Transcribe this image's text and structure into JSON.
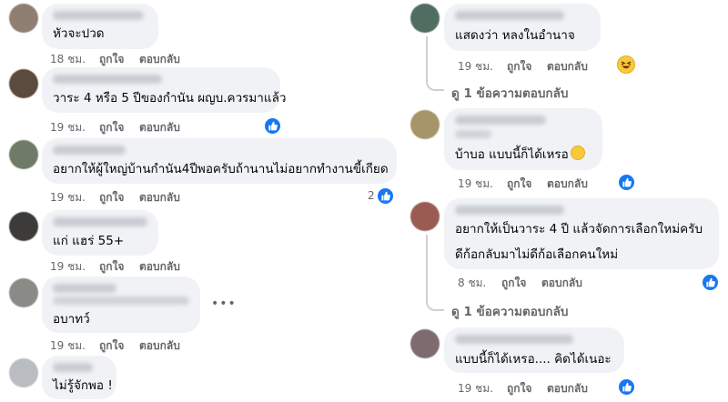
{
  "left_comments": [
    {
      "text": "หัวจะปวด",
      "time": "18 ชม.",
      "like": "ถูกใจ",
      "reply": "ตอบกลับ"
    },
    {
      "text": "วาระ 4 หรือ 5 ปีของกำนัน ผญบ.ควรมาแล้ว",
      "time": "19 ชม.",
      "like": "ถูกใจ",
      "reply": "ตอบกลับ"
    },
    {
      "text": "อยากให้ผู้ใหญ่บ้านกำนัน4ปีพอครับถ้านานไม่อยากทำงานขี้เกียด",
      "time": "19 ชม.",
      "like": "ถูกใจ",
      "reply": "ตอบกลับ",
      "reaction_count": "2"
    },
    {
      "text": "แก่ แฮร่ 55+",
      "time": "19 ชม.",
      "like": "ถูกใจ",
      "reply": "ตอบกลับ"
    },
    {
      "text": "อบาทว์",
      "time": "19 ชม.",
      "like": "ถูกใจ",
      "reply": "ตอบกลับ"
    },
    {
      "text": "ไม่รู้จักพอ !",
      "time": "",
      "like": "",
      "reply": ""
    }
  ],
  "right_comments": [
    {
      "text": "แสดงว่า หลงในอำนาจ",
      "time": "19 ชม.",
      "like": "ถูกใจ",
      "reply": "ตอบกลับ"
    },
    {
      "text": "บ้าบอ แบบนี้ก็ได้เหรอ",
      "time": "19 ชม.",
      "like": "ถูกใจ",
      "reply": "ตอบกลับ"
    },
    {
      "text_line1": "อยากให้เป็นวาระ 4 ปี แล้วจัดการเลือกใหม่ครับ",
      "text_line2": "ดีก้อกลับมาไม่ดีก้อเลือกคนใหม่",
      "time": "8 ชม.",
      "like": "ถูกใจ",
      "reply": "ตอบกลับ"
    },
    {
      "text": "แบบนี้ก็ได้เหรอ.... คิดได้เนอะ",
      "time": "19 ชม.",
      "like": "ถูกใจ",
      "reply": "ตอบกลับ"
    }
  ],
  "view_replies": [
    "ดู 1 ข้อความตอบกลับ",
    "ดู 1 ข้อความตอบกลับ"
  ],
  "more_options": "•••",
  "colors": {
    "bubble": "#f0f2f5",
    "meta": "#65676b",
    "like_blue": "#1877f2",
    "haha": "#f7c93b"
  },
  "icons": [
    "like-reaction-icon",
    "haha-reaction-icon",
    "grin-emoji-icon",
    "more-options-icon"
  ]
}
